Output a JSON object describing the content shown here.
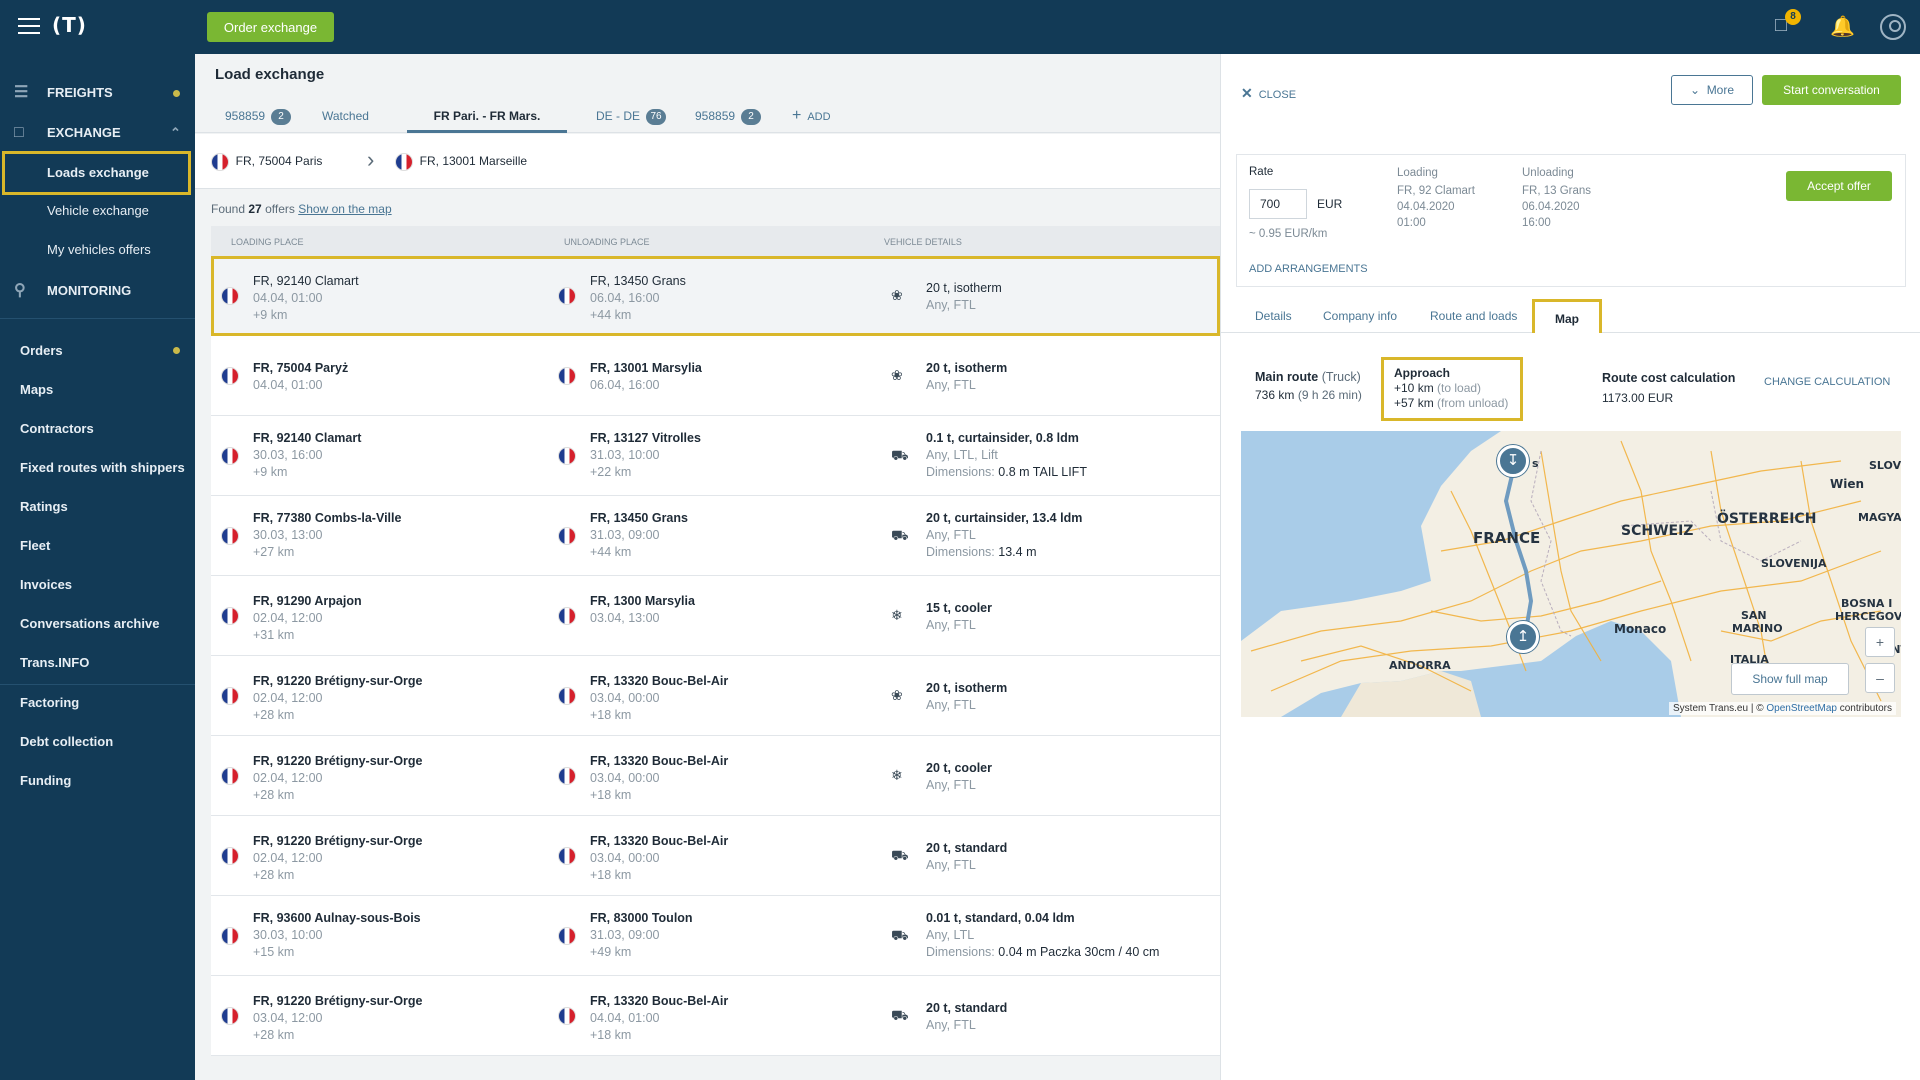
{
  "topbar": {
    "order_button": "Order exchange",
    "messages_count": "8"
  },
  "sidebar": {
    "freights": "FREIGHTS",
    "exchange": "EXCHANGE",
    "loads_exchange": "Loads exchange",
    "vehicle_exchange": "Vehicle exchange",
    "my_vehicles_offers": "My vehicles offers",
    "monitoring": "MONITORING",
    "orders": "Orders",
    "maps": "Maps",
    "contractors": "Contractors",
    "fixed_routes": "Fixed routes with shippers",
    "ratings": "Ratings",
    "fleet": "Fleet",
    "invoices": "Invoices",
    "conversations_archive": "Conversations archive",
    "trans_info": "Trans.INFO",
    "factoring": "Factoring",
    "debt_collection": "Debt collection",
    "funding": "Funding"
  },
  "main": {
    "title": "Load exchange",
    "tabs": [
      {
        "label": "958859",
        "count": "2"
      },
      {
        "label": "Watched"
      },
      {
        "label": "FR Pari. - FR Mars."
      },
      {
        "label": "DE - DE",
        "count": "76"
      },
      {
        "label": "958859",
        "count": "2"
      },
      {
        "label": "ADD"
      }
    ],
    "route_from": "FR, 75004 Paris",
    "route_to": "FR, 13001 Marseille",
    "found_prefix": "Found",
    "found_count": "27",
    "found_suffix": "offers",
    "show_on_map": "Show on the map",
    "columns": {
      "loading": "LOADING PLACE",
      "unloading": "UNLOADING PLACE",
      "vehicle": "VEHICLE DETAILS"
    },
    "rows": [
      {
        "load": "FR, 92140 Clamart",
        "load_date": "04.04, 01:00",
        "load_km": "+9 km",
        "unload": "FR, 13450 Grans",
        "unload_date": "06.04, 16:00",
        "unload_km": "+44 km",
        "vehicle": "20 t, isotherm",
        "veh_sub": "Any, FTL",
        "icon": "truck-isotherm-icon"
      },
      {
        "load": "FR, 75004 Paryż",
        "load_date": "04.04, 01:00",
        "load_km": "",
        "unload": "FR, 13001 Marsylia",
        "unload_date": "06.04, 16:00",
        "unload_km": "",
        "vehicle": "20 t, isotherm",
        "veh_sub": "Any, FTL",
        "icon": "truck-isotherm-icon"
      },
      {
        "load": "FR, 92140 Clamart",
        "load_date": "30.03, 16:00",
        "load_km": "+9 km",
        "unload": "FR, 13127 Vitrolles",
        "unload_date": "31.03, 10:00",
        "unload_km": "+22 km",
        "vehicle": "0.1 t, curtainsider, 0.8 ldm",
        "veh_sub": "Any, LTL, Lift",
        "dim_label": "Dimensions:",
        "dim_value": "0.8 m TAIL LIFT",
        "icon": "truck-curtain-icon"
      },
      {
        "load": "FR, 77380 Combs-la-Ville",
        "load_date": "30.03, 13:00",
        "load_km": "+27 km",
        "unload": "FR, 13450 Grans",
        "unload_date": "31.03, 09:00",
        "unload_km": "+44 km",
        "vehicle": "20 t, curtainsider, 13.4 ldm",
        "veh_sub": "Any, FTL",
        "dim_label": "Dimensions:",
        "dim_value": "13.4 m",
        "icon": "truck-curtain-icon"
      },
      {
        "load": "FR, 91290 Arpajon",
        "load_date": "02.04, 12:00",
        "load_km": "+31 km",
        "unload": "FR, 1300 Marsylia",
        "unload_date": "03.04, 13:00",
        "unload_km": "",
        "vehicle": "15 t, cooler",
        "veh_sub": "Any, FTL",
        "icon": "truck-cooler-icon"
      },
      {
        "load": "FR, 91220 Brétigny-sur-Orge",
        "load_date": "02.04, 12:00",
        "load_km": "+28 km",
        "unload": "FR, 13320 Bouc-Bel-Air",
        "unload_date": "03.04, 00:00",
        "unload_km": "+18 km",
        "vehicle": "20 t, isotherm",
        "veh_sub": "Any, FTL",
        "icon": "truck-isotherm-icon"
      },
      {
        "load": "FR, 91220 Brétigny-sur-Orge",
        "load_date": "02.04, 12:00",
        "load_km": "+28 km",
        "unload": "FR, 13320 Bouc-Bel-Air",
        "unload_date": "03.04, 00:00",
        "unload_km": "+18 km",
        "vehicle": "20 t, cooler",
        "veh_sub": "Any, FTL",
        "icon": "truck-cooler-icon"
      },
      {
        "load": "FR, 91220 Brétigny-sur-Orge",
        "load_date": "02.04, 12:00",
        "load_km": "+28 km",
        "unload": "FR, 13320 Bouc-Bel-Air",
        "unload_date": "03.04, 00:00",
        "unload_km": "+18 km",
        "vehicle": "20 t, standard",
        "veh_sub": "Any, FTL",
        "icon": "truck-standard-icon"
      },
      {
        "load": "FR, 93600 Aulnay-sous-Bois",
        "load_date": "30.03, 10:00",
        "load_km": "+15 km",
        "unload": "FR, 83000 Toulon",
        "unload_date": "31.03, 09:00",
        "unload_km": "+49 km",
        "vehicle": "0.01 t, standard, 0.04 ldm",
        "veh_sub": "Any, LTL",
        "dim_label": "Dimensions:",
        "dim_value": "0.04 m Paczka 30cm / 40 cm",
        "icon": "truck-standard-icon"
      },
      {
        "load": "FR, 91220 Brétigny-sur-Orge",
        "load_date": "03.04, 12:00",
        "load_km": "+28 km",
        "unload": "FR, 13320 Bouc-Bel-Air",
        "unload_date": "04.04, 01:00",
        "unload_km": "+18 km",
        "vehicle": "20 t, standard",
        "veh_sub": "Any, FTL",
        "icon": "truck-standard-icon"
      }
    ]
  },
  "panel": {
    "close": "CLOSE",
    "more": "More",
    "start_conversation": "Start conversation",
    "rate_label": "Rate",
    "rate_value": "700",
    "currency": "EUR",
    "per_km": "~ 0.95 EUR/km",
    "loading_label": "Loading",
    "loading_place": "FR, 92 Clamart",
    "loading_date": "04.04.2020",
    "loading_time": "01:00",
    "unloading_label": "Unloading",
    "unloading_place": "FR, 13 Grans",
    "unloading_date": "06.04.2020",
    "unloading_time": "16:00",
    "accept_offer": "Accept offer",
    "add_arrangements": "ADD ARRANGEMENTS",
    "tabs": [
      "Details",
      "Company info",
      "Route and loads",
      "Map"
    ],
    "main_route_label": "Main route",
    "main_route_mode": "(Truck)",
    "main_route_value": "736 km",
    "main_route_time": "(9 h 26 min)",
    "approach_label": "Approach",
    "approach_load": "+10 km",
    "approach_load_note": "(to load)",
    "approach_unload": "+57 km",
    "approach_unload_note": "(from unload)",
    "cost_label": "Route cost calculation",
    "cost_value": "1173.00 EUR",
    "change_calc": "CHANGE CALCULATION",
    "map": {
      "labels": [
        "FRANCE",
        "SCHWEIZ",
        "ÖSTERREICH",
        "SLOVENIJA",
        "Wien",
        "SLOV",
        "MAGYA",
        "BOSNA I",
        "HERCEGOVIN",
        "SAN",
        "MARINO",
        "Monaco",
        "ANDORRA",
        "ITALIA",
        "MONT",
        "s"
      ],
      "show_full_map": "Show full map",
      "credit_prefix": "System Trans.eu | ©",
      "credit_link": "OpenStreetMap",
      "credit_suffix": "contributors"
    }
  }
}
